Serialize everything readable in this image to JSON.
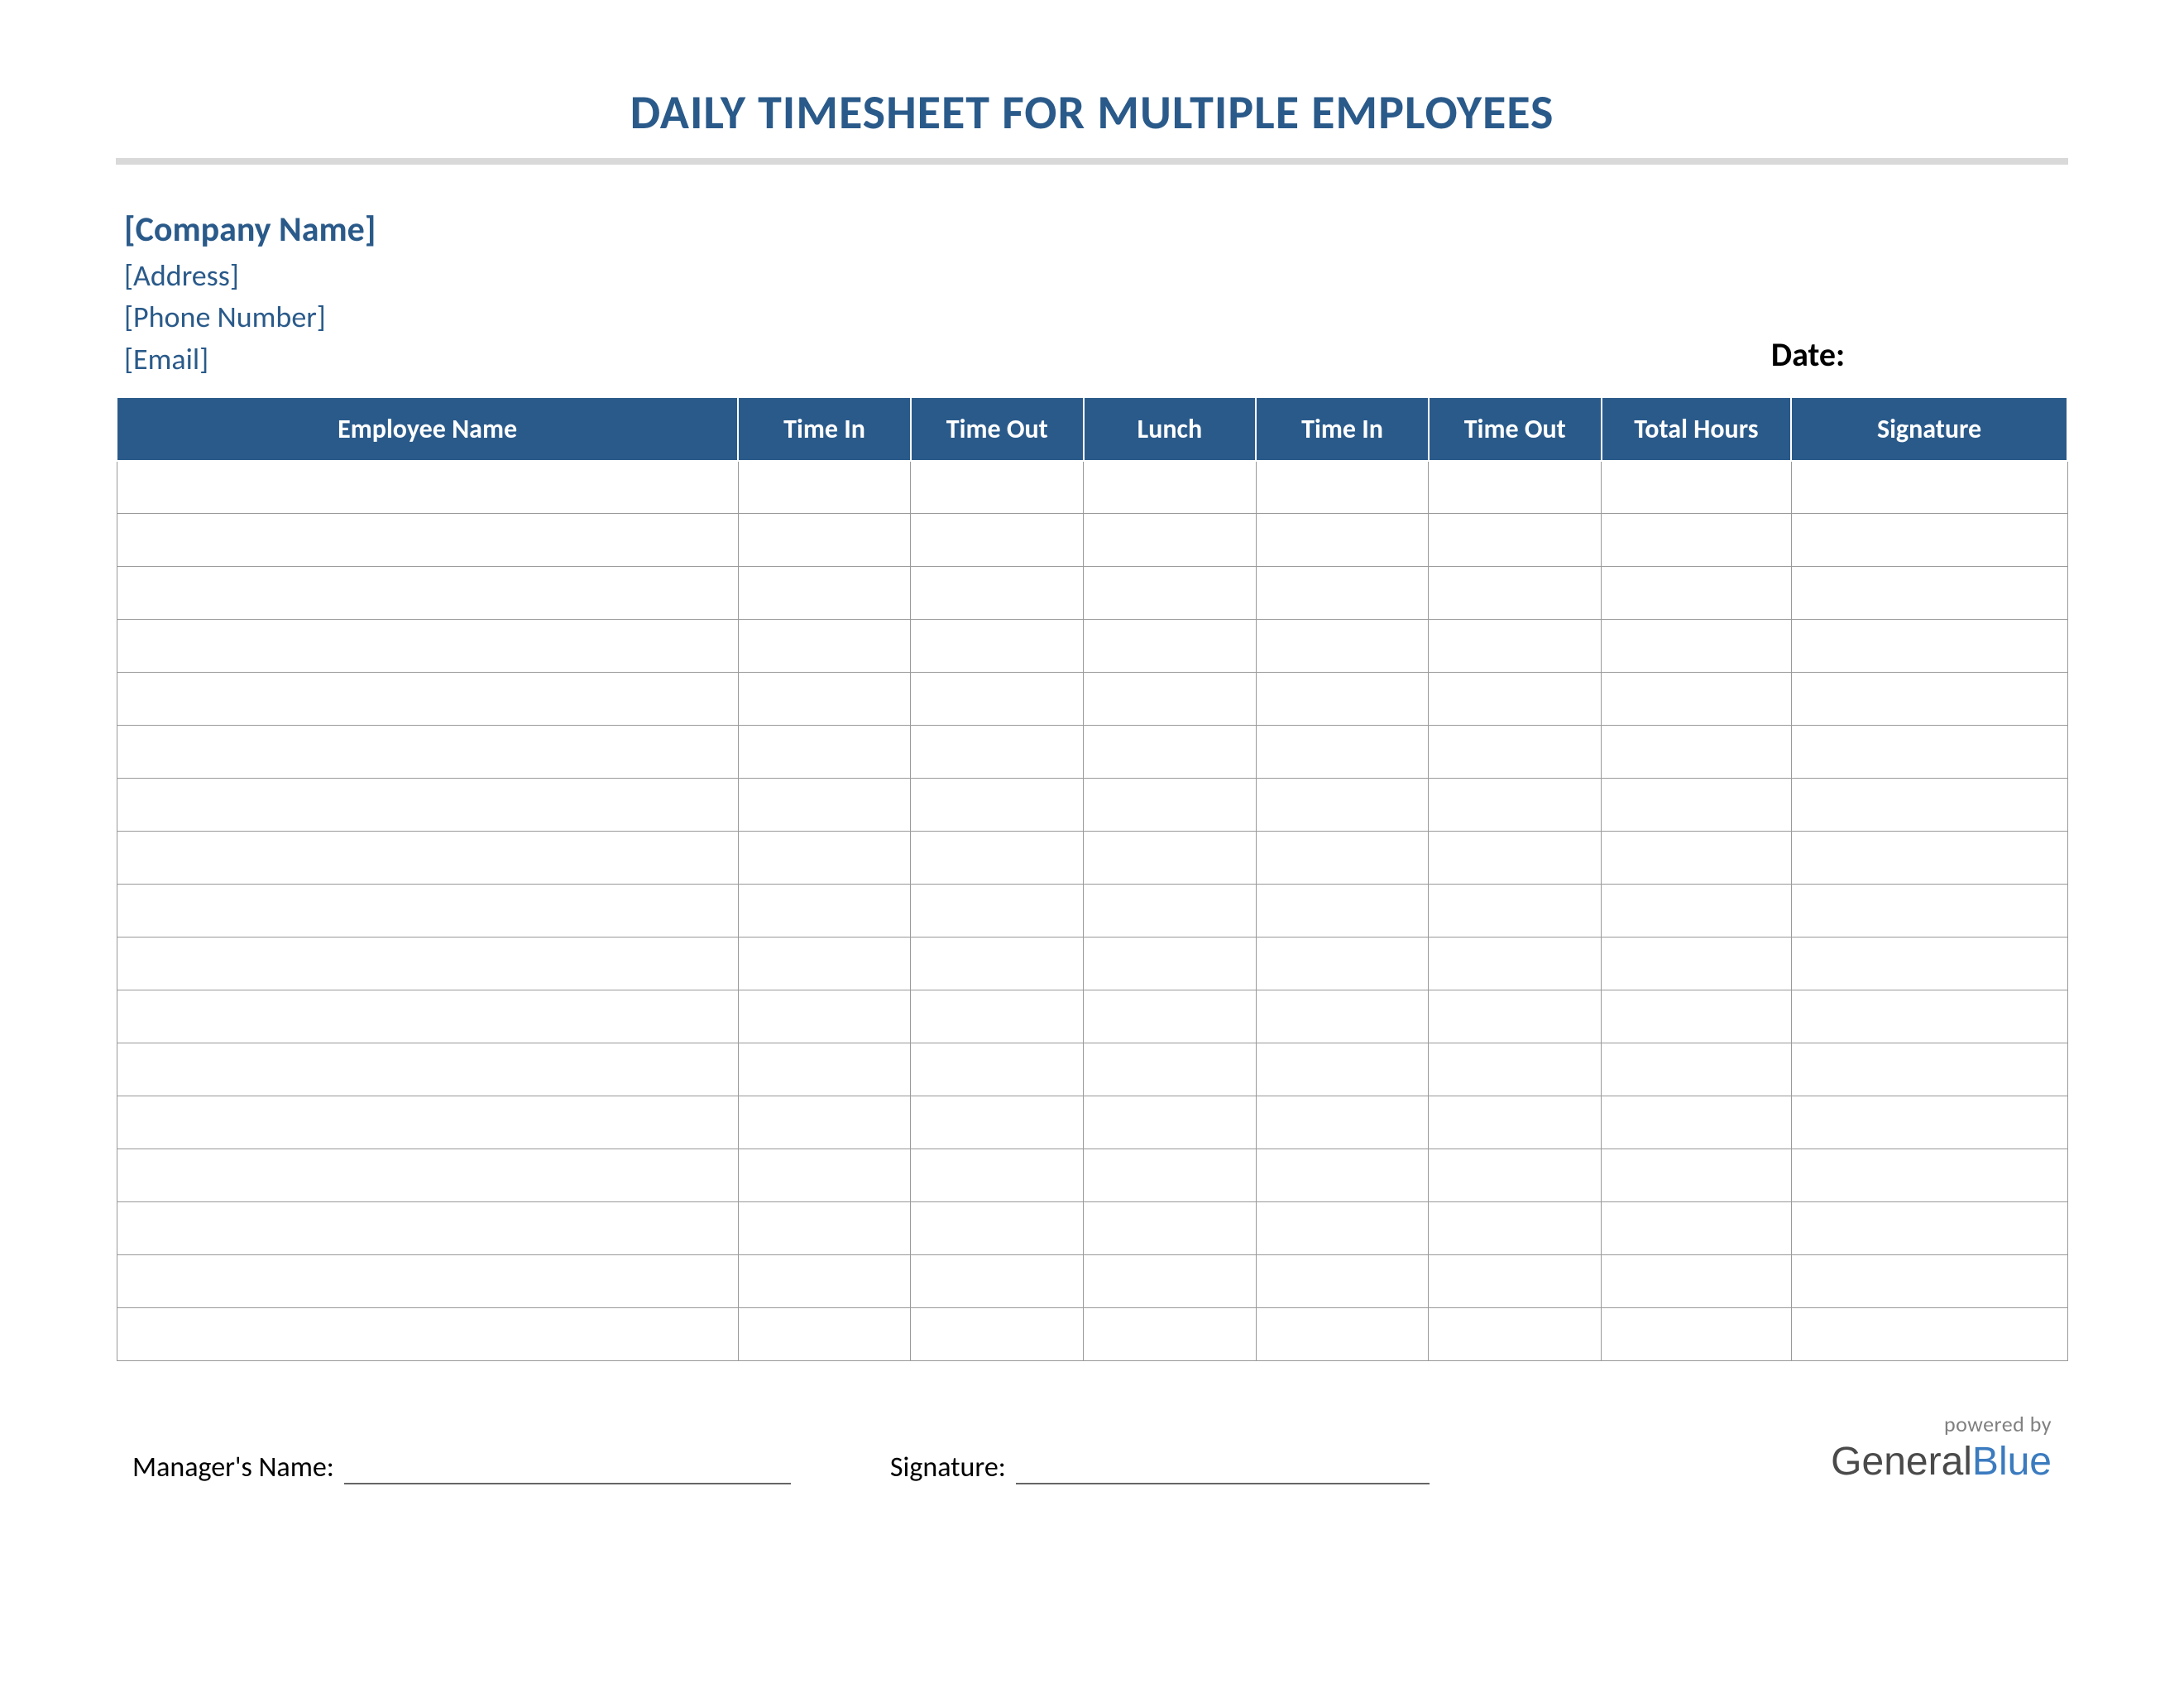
{
  "title": "DAILY TIMESHEET FOR MULTIPLE EMPLOYEES",
  "company": {
    "name": "[Company Name]",
    "address": "[Address]",
    "phone": "[Phone Number]",
    "email": "[Email]"
  },
  "date_label": "Date:",
  "table": {
    "headers": [
      "Employee Name",
      "Time In",
      "Time Out",
      "Lunch",
      "Time In",
      "Time Out",
      "Total Hours",
      "Signature"
    ],
    "row_count": 17
  },
  "footer": {
    "manager_label": "Manager's Name:",
    "signature_label": "Signature:"
  },
  "brand": {
    "powered": "powered by",
    "part1": "General",
    "part2": "Blue"
  }
}
